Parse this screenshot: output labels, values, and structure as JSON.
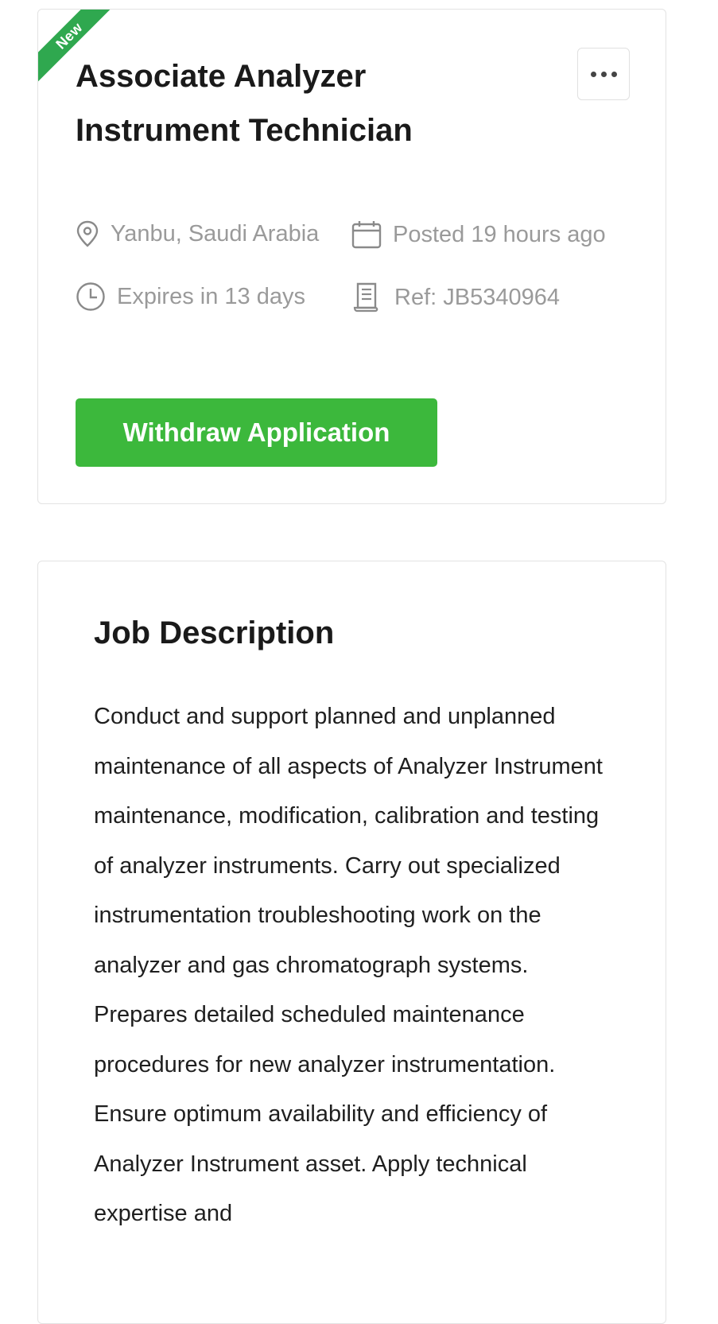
{
  "job_card": {
    "badge": "New",
    "title": "Associate Analyzer Instrument Technician",
    "location": "Yanbu, Saudi Arabia",
    "posted": "Posted 19 hours ago",
    "expires": "Expires in 13 days",
    "ref": "Ref: JB5340964",
    "withdraw_label": "Withdraw Application",
    "colors": {
      "badge": "#2fa84f",
      "button": "#3cb83c"
    }
  },
  "description": {
    "heading": "Job Description",
    "text": "Conduct and support planned and unplanned maintenance of all aspects of Analyzer Instrument maintenance, modification, calibration and testing of analyzer instruments. Carry out specialized instrumentation troubleshooting work on the analyzer and gas chromatograph systems. Prepares detailed scheduled maintenance procedures for new analyzer instrumentation. Ensure optimum availability and efficiency of Analyzer Instrument asset. Apply technical expertise and"
  },
  "icons": {
    "location": "map-pin-icon",
    "posted": "calendar-icon",
    "expires": "clock-icon",
    "ref": "document-icon",
    "more": "more-options-icon"
  }
}
